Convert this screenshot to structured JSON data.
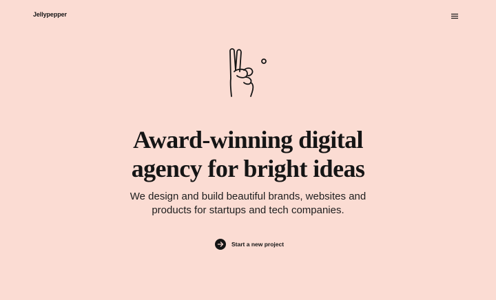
{
  "header": {
    "logo_text": "Jellypepper",
    "menu_icon": "hamburger-menu-icon"
  },
  "hero": {
    "illustration_icon": "peace-hand-icon",
    "headline_line1": "Award-winning digital",
    "headline_line2": "agency for bright ideas",
    "subhead_line1": "We design and build beautiful brands, websites and",
    "subhead_line2": "products for startups and tech companies.",
    "cta_label": "Start a new project",
    "cta_icon": "arrow-right-icon"
  },
  "colors": {
    "background": "#fbdcd3",
    "text": "#151515"
  }
}
